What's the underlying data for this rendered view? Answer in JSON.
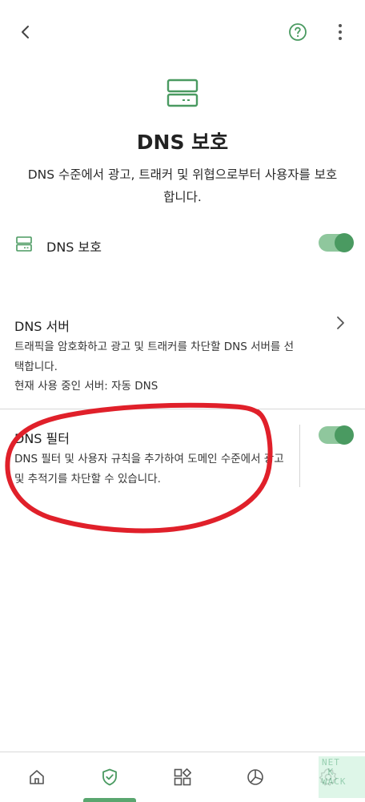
{
  "header": {
    "back_icon": "chevron-left-icon",
    "help_icon": "question-circle-icon",
    "more_icon": "more-vertical-icon"
  },
  "hero": {
    "icon": "dns-server-icon",
    "title": "DNS 보호",
    "subtitle": "DNS 수준에서 광고, 트래커 및 위협으로부터 사용자를 보호합니다."
  },
  "dns_protection": {
    "icon": "dns-server-icon",
    "label": "DNS 보호",
    "enabled": true
  },
  "dns_server": {
    "title": "DNS 서버",
    "description": "트래픽을 암호화하고 광고 및 트래커를 차단할 DNS 서버를 선택합니다.",
    "current": "현재 사용 중인 서버: 자동 DNS"
  },
  "dns_filter": {
    "title": "DNS 필터",
    "description": "DNS 필터 및 사용자 규칙을 추가하여 도메인 수준에서 광고 및 추적기를 차단할 수 있습니다.",
    "enabled": true
  },
  "bottom_nav": {
    "items": [
      "home-icon",
      "shield-check-icon",
      "apps-grid-icon",
      "pie-chart-icon",
      "gear-icon"
    ],
    "active_index": 1
  },
  "watermark": {
    "text": "NET WACK"
  },
  "colors": {
    "accent": "#4a9a61",
    "accent_light": "#8fc79d",
    "annotation_red": "#e0202a"
  }
}
